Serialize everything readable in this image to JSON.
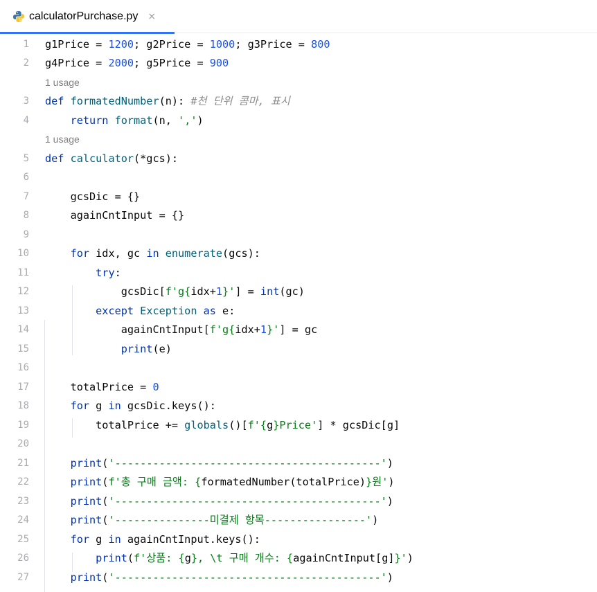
{
  "tab": {
    "filename": "calculatorPurchase.py",
    "close_glyph": "×",
    "icon": "python-file-icon"
  },
  "colors": {
    "keyword": "#0033b3",
    "number": "#1750eb",
    "function": "#00627a",
    "string": "#067d17",
    "comment": "#8c8c8c",
    "accent": "#3574f0"
  },
  "editor": {
    "inlay_hint": "1 usage",
    "lines": [
      {
        "n": "1",
        "tokens": [
          [
            "t",
            "g1Price = "
          ],
          [
            "num",
            "1200"
          ],
          [
            "t",
            "; g2Price = "
          ],
          [
            "num",
            "1000"
          ],
          [
            "t",
            "; g3Price = "
          ],
          [
            "num",
            "800"
          ]
        ]
      },
      {
        "n": "2",
        "tokens": [
          [
            "t",
            "g4Price = "
          ],
          [
            "num",
            "2000"
          ],
          [
            "t",
            "; g5Price = "
          ],
          [
            "num",
            "900"
          ]
        ]
      },
      {
        "hint": true
      },
      {
        "n": "3",
        "tokens": [
          [
            "kw",
            "def "
          ],
          [
            "fn",
            "formatedNumber"
          ],
          [
            "t",
            "(n): "
          ],
          [
            "cmt",
            "#천 단위 콤마, 표시"
          ]
        ]
      },
      {
        "n": "4",
        "tokens": [
          [
            "t",
            "    "
          ],
          [
            "kw",
            "return "
          ],
          [
            "fn",
            "format"
          ],
          [
            "t",
            "(n, "
          ],
          [
            "str",
            "','"
          ],
          [
            "t",
            ")"
          ]
        ]
      },
      {
        "hint": true
      },
      {
        "n": "5",
        "tokens": [
          [
            "kw",
            "def "
          ],
          [
            "fn",
            "calculator"
          ],
          [
            "t",
            "(*gcs):"
          ]
        ]
      },
      {
        "n": "6",
        "tokens": []
      },
      {
        "n": "7",
        "tokens": [
          [
            "t",
            "    gcsDic = {}"
          ]
        ]
      },
      {
        "n": "8",
        "tokens": [
          [
            "t",
            "    againCntInput = {}"
          ]
        ]
      },
      {
        "n": "9",
        "tokens": []
      },
      {
        "n": "10",
        "tokens": [
          [
            "t",
            "    "
          ],
          [
            "kw",
            "for "
          ],
          [
            "t",
            "idx, gc "
          ],
          [
            "kw",
            "in "
          ],
          [
            "fn",
            "enumerate"
          ],
          [
            "t",
            "(gcs):"
          ]
        ]
      },
      {
        "n": "11",
        "tokens": [
          [
            "t",
            "        "
          ],
          [
            "kw",
            "try"
          ],
          [
            "t",
            ":"
          ]
        ]
      },
      {
        "n": "12",
        "tokens": [
          [
            "t",
            "            gcsDic["
          ],
          [
            "str",
            "f'g{"
          ],
          [
            "t",
            "idx+"
          ],
          [
            "num",
            "1"
          ],
          [
            "str",
            "}'"
          ],
          [
            "t",
            "] = "
          ],
          [
            "kw",
            "int"
          ],
          [
            "t",
            "(gc)"
          ]
        ]
      },
      {
        "n": "13",
        "tokens": [
          [
            "t",
            "        "
          ],
          [
            "kw",
            "except "
          ],
          [
            "fn",
            "Exception "
          ],
          [
            "kw",
            "as "
          ],
          [
            "t",
            "e:"
          ]
        ]
      },
      {
        "n": "14",
        "tokens": [
          [
            "t",
            "            againCntInput["
          ],
          [
            "str",
            "f'g{"
          ],
          [
            "t",
            "idx+"
          ],
          [
            "num",
            "1"
          ],
          [
            "str",
            "}'"
          ],
          [
            "t",
            "] = gc"
          ]
        ]
      },
      {
        "n": "15",
        "tokens": [
          [
            "t",
            "            "
          ],
          [
            "kw",
            "print"
          ],
          [
            "t",
            "(e)"
          ]
        ]
      },
      {
        "n": "16",
        "tokens": []
      },
      {
        "n": "17",
        "tokens": [
          [
            "t",
            "    totalPrice = "
          ],
          [
            "num",
            "0"
          ]
        ]
      },
      {
        "n": "18",
        "tokens": [
          [
            "t",
            "    "
          ],
          [
            "kw",
            "for "
          ],
          [
            "t",
            "g "
          ],
          [
            "kw",
            "in "
          ],
          [
            "t",
            "gcsDic.keys():"
          ]
        ]
      },
      {
        "n": "19",
        "tokens": [
          [
            "t",
            "        totalPrice += "
          ],
          [
            "fn",
            "globals"
          ],
          [
            "t",
            "()["
          ],
          [
            "str",
            "f'{"
          ],
          [
            "t",
            "g"
          ],
          [
            "str",
            "}Price'"
          ],
          [
            "t",
            "] * gcsDic[g]"
          ]
        ]
      },
      {
        "n": "20",
        "tokens": []
      },
      {
        "n": "21",
        "tokens": [
          [
            "t",
            "    "
          ],
          [
            "kw",
            "print"
          ],
          [
            "t",
            "("
          ],
          [
            "str",
            "'------------------------------------------'"
          ],
          [
            "t",
            ")"
          ]
        ]
      },
      {
        "n": "22",
        "tokens": [
          [
            "t",
            "    "
          ],
          [
            "kw",
            "print"
          ],
          [
            "t",
            "("
          ],
          [
            "str",
            "f'총 구매 금액: {"
          ],
          [
            "t",
            "formatedNumber(totalPrice)"
          ],
          [
            "str",
            "}원'"
          ],
          [
            "t",
            ")"
          ]
        ]
      },
      {
        "n": "23",
        "tokens": [
          [
            "t",
            "    "
          ],
          [
            "kw",
            "print"
          ],
          [
            "t",
            "("
          ],
          [
            "str",
            "'------------------------------------------'"
          ],
          [
            "t",
            ")"
          ]
        ]
      },
      {
        "n": "24",
        "tokens": [
          [
            "t",
            "    "
          ],
          [
            "kw",
            "print"
          ],
          [
            "t",
            "("
          ],
          [
            "str",
            "'---------------미결제 항목----------------'"
          ],
          [
            "t",
            ")"
          ]
        ]
      },
      {
        "n": "25",
        "tokens": [
          [
            "t",
            "    "
          ],
          [
            "kw",
            "for "
          ],
          [
            "t",
            "g "
          ],
          [
            "kw",
            "in "
          ],
          [
            "t",
            "againCntInput.keys():"
          ]
        ]
      },
      {
        "n": "26",
        "tokens": [
          [
            "t",
            "        "
          ],
          [
            "kw",
            "print"
          ],
          [
            "t",
            "("
          ],
          [
            "str",
            "f'상품: {"
          ],
          [
            "t",
            "g"
          ],
          [
            "str",
            "}, \\t 구매 개수: {"
          ],
          [
            "t",
            "againCntInput[g]"
          ],
          [
            "str",
            "}'"
          ],
          [
            "t",
            ")"
          ]
        ]
      },
      {
        "n": "27",
        "tokens": [
          [
            "t",
            "    "
          ],
          [
            "kw",
            "print"
          ],
          [
            "t",
            "("
          ],
          [
            "str",
            "'------------------------------------------'"
          ],
          [
            "t",
            ")"
          ]
        ]
      }
    ]
  }
}
